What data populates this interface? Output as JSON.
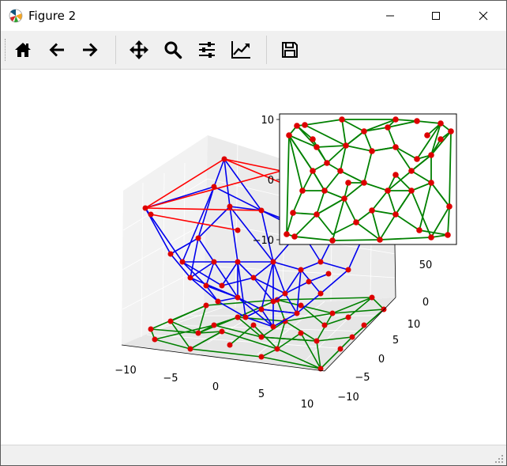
{
  "window": {
    "title": "Figure 2",
    "controls": [
      "minimize",
      "maximize",
      "close"
    ]
  },
  "toolbar": {
    "tools": [
      {
        "name": "home",
        "icon": "home-icon"
      },
      {
        "name": "back",
        "icon": "arrow-left-icon"
      },
      {
        "name": "forward",
        "icon": "arrow-right-icon"
      },
      {
        "name": "pan",
        "icon": "move-icon"
      },
      {
        "name": "zoom",
        "icon": "magnifier-icon"
      },
      {
        "name": "configure-subplots",
        "icon": "sliders-icon"
      },
      {
        "name": "edit-axes",
        "icon": "line-chart-icon"
      },
      {
        "name": "save",
        "icon": "floppy-disk-icon"
      }
    ]
  },
  "chart_data": [
    {
      "type": "3d-wireframe",
      "x_ticks": [
        "−10",
        "−5",
        "0",
        "5",
        "10"
      ],
      "y_ticks": [
        "−10",
        "−5",
        "0",
        "5",
        "10"
      ],
      "z_ticks": [
        "0",
        "50"
      ],
      "xlim": [
        -10,
        10
      ],
      "ylim": [
        -10,
        10
      ],
      "colors": {
        "surface_edges": "#0000ff",
        "top_edges": "#ff0000",
        "floor_edges": "#008000",
        "points": "#ff0000"
      }
    },
    {
      "type": "triangulation",
      "y_ticks": [
        "10",
        "0",
        "−10"
      ],
      "colors": {
        "edges": "#008000",
        "points": "#ff0000"
      }
    }
  ],
  "colors": {
    "toolbar_bg": "#f0f0f0",
    "red": "#ff0000",
    "blue": "#0000ff",
    "green": "#008000"
  }
}
